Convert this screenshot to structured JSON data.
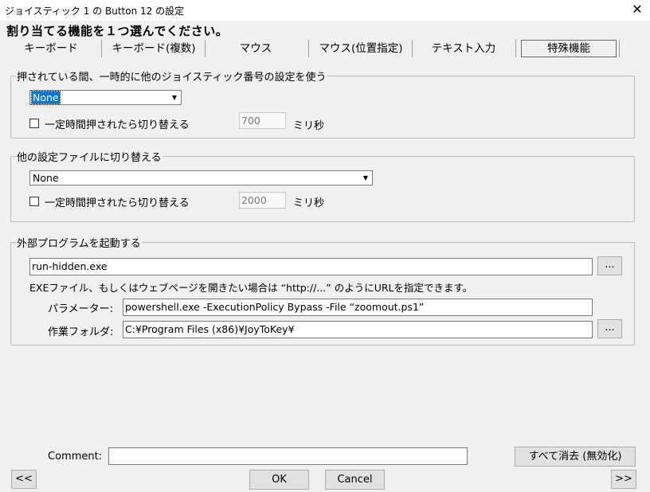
{
  "window": {
    "title": "ジョイスティック 1 の Button 12 の設定",
    "close_glyph": "✕"
  },
  "heading": "割り当てる機能を１つ選んでください。",
  "tabs": [
    {
      "label": "キーボード",
      "active": false
    },
    {
      "label": "キーボード(複数)",
      "active": false
    },
    {
      "label": "マウス",
      "active": false
    },
    {
      "label": "マウス(位置指定)",
      "active": false
    },
    {
      "label": "テキスト入力",
      "active": false
    },
    {
      "label": "特殊機能",
      "active": true
    }
  ],
  "group_joystick": {
    "legend": "押されている間、一時的に他のジョイスティック番号の設定を使う",
    "select_value": "None",
    "checkbox_label": "一定時間押されたら切り替える",
    "checked": false,
    "ms_value": "700",
    "ms_unit": "ミリ秒"
  },
  "group_config": {
    "legend": "他の設定ファイルに切り替える",
    "select_value": "None",
    "checkbox_label": "一定時間押されたら切り替える",
    "checked": false,
    "ms_value": "2000",
    "ms_unit": "ミリ秒"
  },
  "group_program": {
    "legend": "外部プログラムを起動する",
    "program_value": "run-hidden.exe",
    "browse_label": "...",
    "hint": "EXEファイル、もしくはウェブページを開きたい場合は “http://...” のようにURLを指定できます。",
    "param_label": "パラメーター:",
    "param_value": "powershell.exe -ExecutionPolicy Bypass -File “zoomout.ps1”",
    "folder_label": "作業フォルダ:",
    "folder_value": "C:¥Program Files (x86)¥JoyToKey¥",
    "folder_browse_label": "..."
  },
  "footer": {
    "comment_label": "Comment:",
    "comment_value": "",
    "clear_all_label": "すべて消去 (無効化)",
    "prev_label": "<<",
    "ok_label": "OK",
    "cancel_label": "Cancel",
    "next_label": ">>"
  },
  "glyphs": {
    "dropdown_arrow": "▼"
  }
}
